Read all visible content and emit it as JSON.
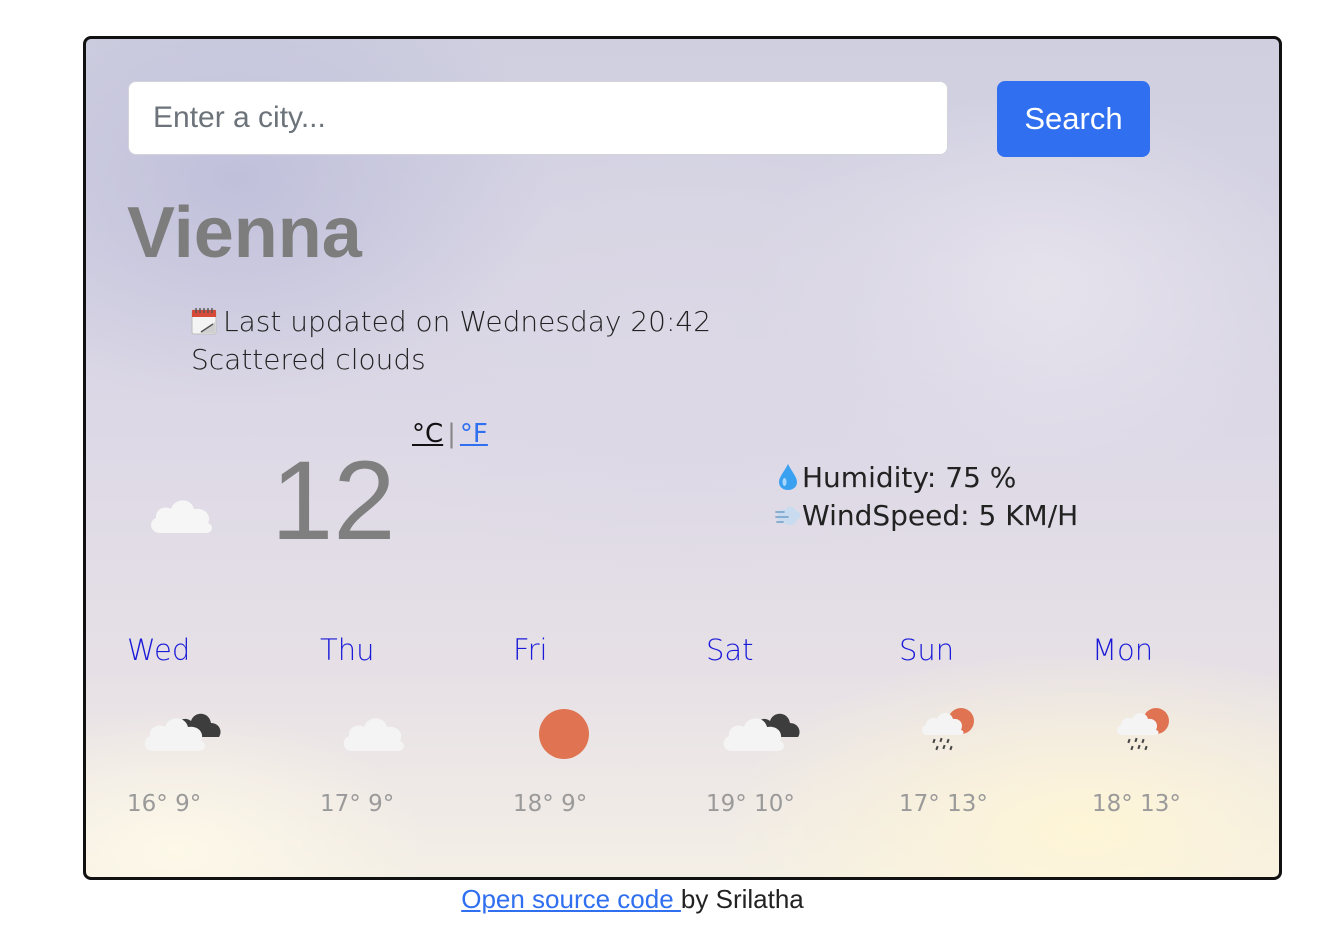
{
  "search": {
    "placeholder": "Enter a city...",
    "value": "",
    "button_label": "Search"
  },
  "current": {
    "city": "Vienna",
    "updated_label": "Last updated on Wednesday 20:42",
    "description": "Scattered clouds",
    "temperature": "12",
    "unit_celsius": "°C",
    "unit_separator": "|",
    "unit_fahrenheit": "°F",
    "condition_icon": "cloud-icon",
    "humidity_label": "Humidity: 75 %",
    "wind_label": "WindSpeed: 5 KM/H"
  },
  "forecast": [
    {
      "day": "Wed",
      "temps": "16° 9°",
      "icon": "broken-clouds-icon"
    },
    {
      "day": "Thu",
      "temps": "17° 9°",
      "icon": "cloud-icon"
    },
    {
      "day": "Fri",
      "temps": "18° 9°",
      "icon": "sun-icon"
    },
    {
      "day": "Sat",
      "temps": "19° 10°",
      "icon": "broken-clouds-icon"
    },
    {
      "day": "Sun",
      "temps": "17° 13°",
      "icon": "rain-sun-icon"
    },
    {
      "day": "Mon",
      "temps": "18° 13°",
      "icon": "rain-sun-icon"
    }
  ],
  "footer": {
    "link_text": "Open source code ",
    "suffix": "by Srilatha"
  },
  "colors": {
    "accent": "#2f6ff0",
    "day_name": "#1a1ad8",
    "sun": "#e07452"
  }
}
